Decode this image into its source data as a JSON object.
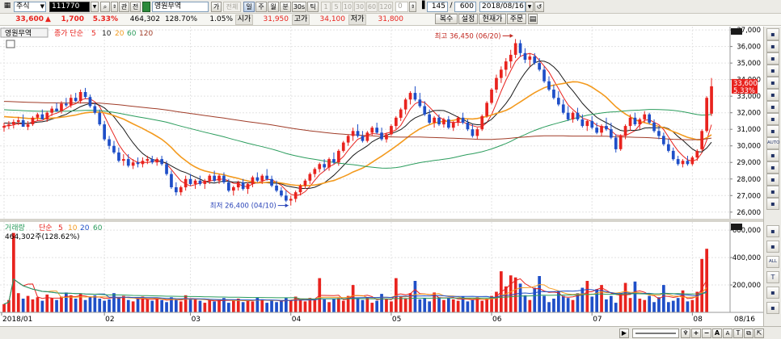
{
  "toolbar": {
    "market": "주식",
    "code": "111770",
    "tab_related": "관",
    "tab_all": "전",
    "stock_name": "영원무역",
    "btn_ga": "가",
    "btn_jeoncheong": "전체",
    "periods": [
      "일",
      "주",
      "월",
      "분",
      "30s",
      "틱"
    ],
    "interval_buttons": [
      "1",
      "5",
      "10",
      "30",
      "60",
      "120",
      "0"
    ],
    "count": "145",
    "separator": "/",
    "total": "600",
    "date": "2018/08/16",
    "right_buttons": [
      "복수",
      "설정",
      "현재가",
      "주문"
    ]
  },
  "quote": {
    "price": "33,600",
    "up_arrow": "▲",
    "change": "1,700",
    "change_pct": "5.33%",
    "volume": "464,302",
    "vol_ratio": "128.70%",
    "turnover": "1.05%",
    "open_label": "시가",
    "open": "31,950",
    "high_label": "고가",
    "high": "34,100",
    "low_label": "저가",
    "low": "31,800"
  },
  "price_panel": {
    "title": "영원무역",
    "ma_label": "종가 단순",
    "ma_periods": [
      "5",
      "10",
      "20",
      "60",
      "120"
    ],
    "ma_colors": [
      "#e8231e",
      "#1a1a1a",
      "#f39a1e",
      "#2a9c5c",
      "#a03c28"
    ],
    "y_ticks": [
      "37,000",
      "36,000",
      "35,000",
      "34,000",
      "33,000",
      "32,000",
      "31,000",
      "30,000",
      "29,000",
      "28,000",
      "27,000",
      "26,000"
    ],
    "last_price_tag": "33,600",
    "last_pct_tag": "5.33%",
    "max_annotation": "최고 36,450 (06/20)",
    "min_annotation": "최저 26,400 (04/10)"
  },
  "volume_panel": {
    "title": "거래량",
    "ma_label": "단순",
    "ma_periods": [
      "5",
      "10",
      "20",
      "60"
    ],
    "current": "464,302주(128.62%)",
    "y_ticks": [
      "600,000",
      "400,000",
      "200,000"
    ]
  },
  "x_axis": {
    "labels": [
      "2018/01",
      "02",
      "03",
      "04",
      "05",
      "06",
      "07",
      "08"
    ],
    "last_label": "08/16"
  },
  "side_toolbar": {
    "icons": [
      "expand-icon",
      "notes-icon",
      "settings-icon",
      "drawing-icon",
      "zoom-icon",
      "cursor-icon",
      "crosshair-icon",
      "trendline-icon",
      "ray-icon",
      "auto-icon",
      "channel-icon",
      "pattern-icon",
      "fibonacci-icon",
      "text-icon",
      "delete-icon"
    ],
    "labels": [
      "",
      "",
      "",
      "",
      "",
      "",
      "",
      "",
      "",
      "AUTO",
      "",
      "",
      "",
      "",
      ""
    ],
    "lower_icons": [
      "indicator-icon",
      "compare-icon",
      "all-icon",
      "text-tool-icon",
      "clear-icon",
      "back-icon"
    ],
    "lower_labels": [
      "",
      "",
      "ALL",
      "T",
      "",
      ""
    ]
  },
  "bottom_bar": {
    "icons": [
      "scroll-right-icon",
      "range-slider-icon",
      "reset-icon",
      "zoom-in-icon",
      "zoom-out-icon",
      "font-up-icon",
      "font-down-icon",
      "print-icon",
      "copy-icon",
      "export-icon"
    ],
    "labels": [
      "▶",
      "",
      "♆",
      "+",
      "−",
      "A",
      "A",
      "T",
      "",
      ""
    ]
  },
  "chart_data": [
    {
      "type": "candlestick",
      "title": "영원무역",
      "ylim": [
        25600,
        37200
      ],
      "ohlc": [
        [
          31100,
          31400,
          30850,
          31200
        ],
        [
          31200,
          31500,
          31000,
          31300
        ],
        [
          31300,
          31600,
          31050,
          31450
        ],
        [
          31450,
          31750,
          31250,
          31550
        ],
        [
          31550,
          31900,
          31300,
          31150
        ],
        [
          31150,
          31500,
          30950,
          31300
        ],
        [
          31300,
          31800,
          31200,
          31700
        ],
        [
          31700,
          32000,
          31500,
          31900
        ],
        [
          31900,
          32200,
          31600,
          31600
        ],
        [
          31600,
          32100,
          31450,
          32000
        ],
        [
          32000,
          32400,
          31800,
          32250
        ],
        [
          32250,
          32600,
          32050,
          32100
        ],
        [
          32100,
          32700,
          31950,
          32550
        ],
        [
          32550,
          32900,
          32350,
          32450
        ],
        [
          32450,
          33100,
          32300,
          32900
        ],
        [
          32900,
          33200,
          32650,
          32700
        ],
        [
          32700,
          33400,
          32550,
          33250
        ],
        [
          33250,
          33500,
          32850,
          32950
        ],
        [
          32950,
          33100,
          32300,
          32400
        ],
        [
          32400,
          32600,
          31900,
          32000
        ],
        [
          32000,
          32200,
          31200,
          31300
        ],
        [
          31300,
          31500,
          30300,
          30400
        ],
        [
          30400,
          30600,
          29800,
          30000
        ],
        [
          30000,
          30300,
          29500,
          29600
        ],
        [
          29600,
          29900,
          29000,
          29100
        ],
        [
          29100,
          29500,
          28800,
          29200
        ],
        [
          29200,
          29500,
          28700,
          28800
        ],
        [
          28800,
          29200,
          28600,
          29000
        ],
        [
          29000,
          29300,
          28700,
          28900
        ],
        [
          28900,
          29300,
          28700,
          29100
        ],
        [
          29100,
          29400,
          28900,
          29200
        ],
        [
          29200,
          29400,
          28900,
          29000
        ],
        [
          29000,
          29300,
          28800,
          29200
        ],
        [
          29200,
          29400,
          28800,
          28900
        ],
        [
          28900,
          29100,
          28200,
          28300
        ],
        [
          28300,
          28500,
          27400,
          27500
        ],
        [
          27500,
          27800,
          27000,
          27200
        ],
        [
          27200,
          27600,
          27000,
          27500
        ],
        [
          27500,
          28200,
          27300,
          28000
        ],
        [
          28000,
          28300,
          27600,
          27700
        ],
        [
          27700,
          28000,
          27400,
          27900
        ],
        [
          27900,
          28200,
          27600,
          27700
        ],
        [
          27700,
          28000,
          27400,
          27900
        ],
        [
          27900,
          28300,
          27700,
          28200
        ],
        [
          28200,
          28500,
          27800,
          27900
        ],
        [
          27900,
          28300,
          27700,
          28200
        ],
        [
          28200,
          28400,
          27700,
          27800
        ],
        [
          27800,
          28000,
          27200,
          27300
        ],
        [
          27300,
          27600,
          27000,
          27500
        ],
        [
          27500,
          27900,
          27300,
          27800
        ],
        [
          27800,
          28000,
          27300,
          27400
        ],
        [
          27400,
          27800,
          27100,
          27700
        ],
        [
          27700,
          28200,
          27500,
          28100
        ],
        [
          28100,
          28400,
          27800,
          27900
        ],
        [
          27900,
          28300,
          27700,
          28200
        ],
        [
          28200,
          28600,
          27900,
          28000
        ],
        [
          28000,
          28200,
          27500,
          27600
        ],
        [
          27600,
          27900,
          27200,
          27300
        ],
        [
          27300,
          27500,
          26900,
          27000
        ],
        [
          27000,
          27300,
          26600,
          26700
        ],
        [
          26700,
          27000,
          26400,
          26800
        ],
        [
          26800,
          27300,
          26600,
          27200
        ],
        [
          27200,
          27700,
          27000,
          27600
        ],
        [
          27600,
          28000,
          27400,
          27900
        ],
        [
          27900,
          28400,
          27700,
          28300
        ],
        [
          28300,
          28700,
          28100,
          28600
        ],
        [
          28600,
          29000,
          28400,
          28900
        ],
        [
          28900,
          29200,
          28500,
          28700
        ],
        [
          28700,
          29300,
          28500,
          29200
        ],
        [
          29200,
          29600,
          28900,
          29000
        ],
        [
          29000,
          29800,
          28800,
          29700
        ],
        [
          29700,
          30300,
          29600,
          30200
        ],
        [
          30200,
          30700,
          30000,
          30600
        ],
        [
          30600,
          31100,
          30300,
          30900
        ],
        [
          30900,
          31300,
          30500,
          30600
        ],
        [
          30600,
          30900,
          30200,
          30300
        ],
        [
          30300,
          30900,
          30200,
          30800
        ],
        [
          30800,
          31200,
          30600,
          31100
        ],
        [
          31100,
          31400,
          30700,
          30800
        ],
        [
          30800,
          31100,
          30300,
          30400
        ],
        [
          30400,
          30800,
          30200,
          30700
        ],
        [
          30700,
          31300,
          30600,
          31200
        ],
        [
          31200,
          31800,
          31000,
          31700
        ],
        [
          31700,
          32300,
          31500,
          32200
        ],
        [
          32200,
          32900,
          31900,
          32800
        ],
        [
          32800,
          33300,
          32500,
          33200
        ],
        [
          33200,
          33600,
          32700,
          32800
        ],
        [
          32800,
          33200,
          32300,
          32400
        ],
        [
          32400,
          32700,
          31800,
          31900
        ],
        [
          31900,
          32200,
          31300,
          31400
        ],
        [
          31400,
          31800,
          31100,
          31700
        ],
        [
          31700,
          31900,
          31200,
          31300
        ],
        [
          31300,
          31700,
          31100,
          31600
        ],
        [
          31600,
          31800,
          31000,
          31100
        ],
        [
          31100,
          31500,
          30900,
          31400
        ],
        [
          31400,
          31800,
          31200,
          31700
        ],
        [
          31700,
          32000,
          31300,
          31400
        ],
        [
          31400,
          31600,
          30900,
          31000
        ],
        [
          31000,
          31300,
          30500,
          30600
        ],
        [
          30600,
          31100,
          30400,
          31000
        ],
        [
          31000,
          31900,
          30900,
          31800
        ],
        [
          31800,
          32700,
          31700,
          32600
        ],
        [
          32600,
          33500,
          32500,
          33400
        ],
        [
          33400,
          34300,
          33200,
          34100
        ],
        [
          34100,
          34800,
          33800,
          34600
        ],
        [
          34600,
          35300,
          34200,
          35100
        ],
        [
          35100,
          35800,
          34700,
          35500
        ],
        [
          35500,
          36450,
          35300,
          36200
        ],
        [
          36200,
          36400,
          35400,
          35600
        ],
        [
          35600,
          35900,
          35000,
          35200
        ],
        [
          35200,
          35600,
          34800,
          35400
        ],
        [
          35400,
          35600,
          34900,
          35000
        ],
        [
          35000,
          35300,
          34500,
          34600
        ],
        [
          34600,
          34800,
          33800,
          33900
        ],
        [
          33900,
          34200,
          33300,
          33400
        ],
        [
          33400,
          33700,
          32800,
          32900
        ],
        [
          32900,
          33300,
          32400,
          32500
        ],
        [
          32500,
          32800,
          31900,
          32000
        ],
        [
          32000,
          32400,
          31500,
          31600
        ],
        [
          31600,
          32100,
          31400,
          32000
        ],
        [
          32000,
          32300,
          31500,
          31600
        ],
        [
          31600,
          31900,
          31100,
          31200
        ],
        [
          31200,
          31600,
          30900,
          31500
        ],
        [
          31500,
          31800,
          31000,
          31100
        ],
        [
          31100,
          31400,
          30700,
          30800
        ],
        [
          30800,
          31300,
          30600,
          31200
        ],
        [
          31200,
          31700,
          30900,
          31000
        ],
        [
          31000,
          31400,
          30400,
          30500
        ],
        [
          30500,
          30700,
          29600,
          29800
        ],
        [
          29800,
          30700,
          29700,
          30600
        ],
        [
          30600,
          31300,
          30400,
          31200
        ],
        [
          31200,
          31900,
          30900,
          31700
        ],
        [
          31700,
          32000,
          31200,
          31300
        ],
        [
          31300,
          31700,
          31000,
          31600
        ],
        [
          31600,
          32100,
          31400,
          31900
        ],
        [
          31900,
          32000,
          31300,
          31400
        ],
        [
          31400,
          31600,
          30800,
          30900
        ],
        [
          30900,
          31200,
          30400,
          30600
        ],
        [
          30600,
          30800,
          30000,
          30100
        ],
        [
          30100,
          30400,
          29600,
          29700
        ],
        [
          29700,
          29900,
          29100,
          29200
        ],
        [
          29200,
          29400,
          28800,
          28900
        ],
        [
          28900,
          29200,
          28700,
          29100
        ],
        [
          29100,
          29400,
          28800,
          28900
        ],
        [
          28900,
          29400,
          28800,
          29300
        ],
        [
          29300,
          29800,
          29100,
          29700
        ],
        [
          29800,
          31000,
          29700,
          30900
        ],
        [
          30900,
          33000,
          30800,
          32900
        ],
        [
          31950,
          34100,
          31800,
          33600
        ]
      ],
      "ma_periods": [
        5,
        10,
        20,
        60,
        120
      ],
      "max_label": "최고 36,450 (06/20)",
      "min_label": "최저 26,400 (04/10)"
    },
    {
      "type": "bar",
      "title": "거래량",
      "ylim": [
        0,
        660000
      ],
      "values": [
        60000,
        90000,
        580000,
        140000,
        100000,
        120000,
        95000,
        110000,
        85000,
        130000,
        105000,
        90000,
        115000,
        145000,
        125000,
        100000,
        135000,
        90000,
        110000,
        125000,
        100000,
        85000,
        95000,
        140000,
        105000,
        120000,
        90000,
        80000,
        100000,
        115000,
        95000,
        85000,
        100000,
        90000,
        75000,
        110000,
        95000,
        80000,
        125000,
        95000,
        100000,
        85000,
        70000,
        90000,
        80000,
        95000,
        105000,
        70000,
        85000,
        100000,
        75000,
        90000,
        80000,
        110000,
        95000,
        70000,
        90000,
        75000,
        85000,
        105000,
        90000,
        115000,
        95000,
        80000,
        105000,
        90000,
        250000,
        95000,
        75000,
        100000,
        105000,
        85000,
        120000,
        200000,
        105000,
        90000,
        110000,
        70000,
        85000,
        135000,
        95000,
        80000,
        250000,
        115000,
        100000,
        140000,
        230000,
        95000,
        105000,
        80000,
        145000,
        110000,
        90000,
        105000,
        95000,
        85000,
        115000,
        80000,
        90000,
        110000,
        85000,
        100000,
        120000,
        150000,
        300000,
        190000,
        270000,
        255000,
        210000,
        125000,
        90000,
        180000,
        265000,
        120000,
        75000,
        100000,
        155000,
        120000,
        105000,
        90000,
        140000,
        180000,
        230000,
        115000,
        170000,
        200000,
        95000,
        120000,
        70000,
        140000,
        215000,
        105000,
        225000,
        100000,
        90000,
        120000,
        75000,
        110000,
        200000,
        75000,
        85000,
        105000,
        160000,
        80000,
        90000,
        150000,
        390000,
        464302
      ],
      "ma_periods": [
        5,
        10,
        20,
        60
      ],
      "current_label": "464,302주(128.62%)"
    }
  ]
}
